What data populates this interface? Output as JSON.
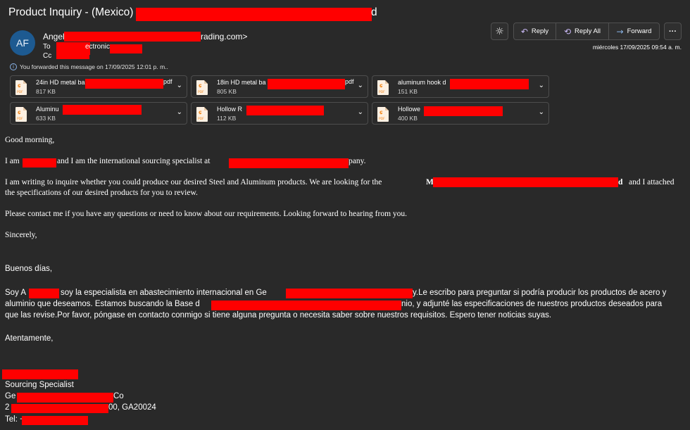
{
  "subject": "Product Inquiry - (Mexico)",
  "subject_tail": "d",
  "sender": {
    "initials": "AF",
    "name_start": "Angel",
    "email_tail": "rading.com>"
  },
  "to": {
    "label": "To",
    "value": "ectronic"
  },
  "cc": {
    "label": "Cc"
  },
  "forward_notice": "You forwarded this message on 17/09/2025 12:01 p. m..",
  "toolbar": {
    "reply": "Reply",
    "reply_all": "Reply All",
    "forward": "Forward",
    "more": "···"
  },
  "date": "miércoles 17/09/2025 09:54 a. m.",
  "attachments": [
    {
      "name_start": "24in HD metal ba",
      "name_end": "pdf",
      "size": "817 KB",
      "icon": "pdf-icon"
    },
    {
      "name_start": "18in HD metal ba",
      "name_end": "pdf",
      "size": "805 KB",
      "icon": "pdf-icon"
    },
    {
      "name_start": "aluminum hook d",
      "name_end": "",
      "size": "151 KB",
      "icon": "pdf-icon"
    },
    {
      "name_start": "Aluminu",
      "name_end": "",
      "size": "633 KB",
      "icon": "pdf-icon"
    },
    {
      "name_start": "Hollow R",
      "name_end": "",
      "size": "112 KB",
      "icon": "pdf-icon"
    },
    {
      "name_start": "Hollowe",
      "name_end": "",
      "size": "400 KB",
      "icon": "pdf-icon"
    }
  ],
  "body_en": {
    "greeting": "Good morning,",
    "intro_a": "I am",
    "intro_b": "and I am the international sourcing specialist at",
    "intro_c": "pany.",
    "p1_a": "I am writing to inquire whether you could produce our desired Steel and Aluminum products. We are looking for the",
    "p1_b": "M",
    "p1_c": "d",
    "p1_d": "and I attached",
    "p1_line2": "the specifications of our desired products for you to review.",
    "p2": "Please contact me if you have any questions or need to know about our requirements. Looking forward to hearing from you.",
    "closing": "Sincerely,"
  },
  "body_es": {
    "greeting": "Buenos días,",
    "l1_a": "Soy A",
    "l1_b": "soy la especialista en abastecimiento internacional en Ge",
    "l1_c": "y.Le escribo para preguntar si podría producir los productos de acero y",
    "l2_a": "aluminio que deseamos. Estamos buscando la Base d",
    "l2_b": "nio, y adjunté las especificaciones de nuestros productos deseados para",
    "l3": "que las revise.Por favor, póngase en contacto conmigo si tiene alguna pregunta o necesita saber sobre nuestros requisitos. Espero tener noticias suyas.",
    "closing": "Atentamente,"
  },
  "signature": {
    "title": "Sourcing Specialist",
    "company_start": "Ge",
    "company_end": "Co",
    "address_start": "2",
    "address_end": "00, GA20024",
    "tel": "Tel: +"
  },
  "colors": {
    "background": "#292929",
    "redaction": "#ff0000",
    "avatar": "#1d5a91",
    "accent": "#c9b8f5"
  }
}
